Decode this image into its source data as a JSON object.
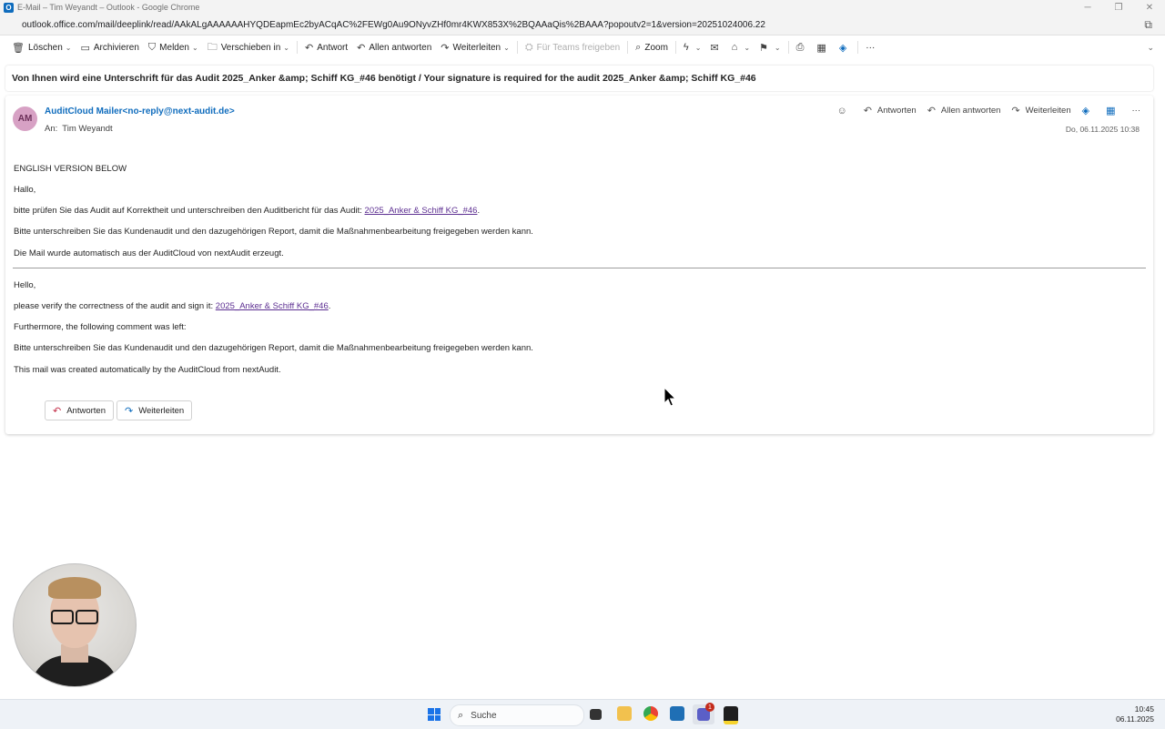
{
  "window": {
    "title": "E-Mail – Tim Weyandt – Outlook - Google Chrome",
    "url": "outlook.office.com/mail/deeplink/read/AAkALgAAAAAAHYQDEapmEc2byACqAC%2FEWg0Au9ONyvZHf0mr4KWX853X%2BQAAaQis%2BAAA?popoutv2=1&version=20251024006.22",
    "app_icon": "O"
  },
  "ribbon": {
    "delete": "Löschen",
    "archive": "Archivieren",
    "report": "Melden",
    "move": "Verschieben in",
    "reply": "Antwort",
    "reply_all": "Allen antworten",
    "forward": "Weiterleiten",
    "share_teams": "Für Teams freigeben",
    "zoom": "Zoom",
    "more": "···"
  },
  "subject": "Von Ihnen wird eine Unterschrift für das Audit 2025_Anker &amp; Schiff KG_#46 benötigt / Your signature is required for the audit 2025_Anker &amp; Schiff KG_#46",
  "message": {
    "avatar_initials": "AM",
    "sender": "AuditCloud Mailer<no-reply@next-audit.de>",
    "to_label": "An:",
    "to_name": "Tim Weyandt",
    "date": "Do, 06.11.2025 10:38",
    "actions": {
      "reply": "Antworten",
      "reply_all": "Allen antworten",
      "forward": "Weiterleiten",
      "more": "···"
    },
    "body": {
      "english_below": "ENGLISH VERSION BELOW",
      "de_greeting": "Hallo,",
      "de_line1_prefix": "bitte prüfen Sie das Audit auf Korrektheit und unterschreiben den Auditbericht für das Audit: ",
      "de_link": "2025_Anker & Schiff KG_#46",
      "de_line1_suffix": ".",
      "de_line2": "Bitte unterschreiben Sie das Kundenaudit und den dazugehörigen Report, damit die Maßnahmenbearbeitung freigegeben werden kann.",
      "de_line3": "Die Mail wurde automatisch aus der AuditCloud von nextAudit erzeugt.",
      "en_greeting": "Hello,",
      "en_line1_prefix": "please verify the correctness of the audit and sign it: ",
      "en_link": "2025_Anker & Schiff KG_#46",
      "en_line1_suffix": ".",
      "en_line2": "Furthermore, the following comment was left:",
      "en_line3": "Bitte unterschreiben Sie das Kundenaudit und den dazugehörigen Report, damit die Maßnahmenbearbeitung freigegeben werden kann.",
      "en_line4": "This mail was created automatically by the AuditCloud from nextAudit."
    },
    "bottom_reply": "Antworten",
    "bottom_forward": "Weiterleiten"
  },
  "taskbar": {
    "search_placeholder": "Suche",
    "teams_badge": "1",
    "time": "10:45",
    "date": "06.11.2025"
  },
  "colors": {
    "accent": "#0f6cbd",
    "link_visited": "#5c2e91",
    "avatar_bg": "#d7a1c4"
  }
}
